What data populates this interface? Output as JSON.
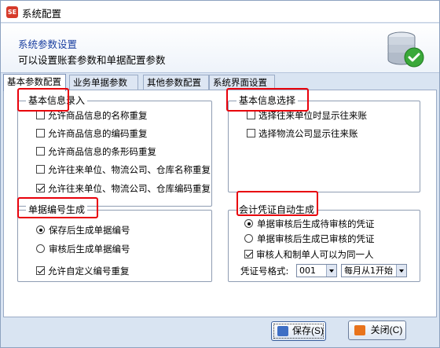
{
  "window": {
    "title": "系统配置",
    "icon_text": "SE"
  },
  "header": {
    "title": "系统参数设置",
    "subtitle": "可以设置账套参数和单据配置参数",
    "icon": "database-check-icon"
  },
  "tabs": [
    {
      "label": "基本参数配置",
      "active": true
    },
    {
      "label": "业务单据参数",
      "active": false
    },
    {
      "label": "其他参数配置",
      "active": false
    },
    {
      "label": "系统界面设置",
      "active": false
    }
  ],
  "basic_info": {
    "title": "基本信息录入",
    "options": [
      {
        "label": "允许商品信息的名称重复",
        "checked": false
      },
      {
        "label": "允许商品信息的编码重复",
        "checked": false
      },
      {
        "label": "允许商品信息的条形码重复",
        "checked": false
      },
      {
        "label": "允许往来单位、物流公司、仓库名称重复",
        "checked": false
      },
      {
        "label": "允许往来单位、物流公司、仓库编码重复",
        "checked": true
      }
    ]
  },
  "basic_select": {
    "title": "基本信息选择",
    "options": [
      {
        "label": "选择往来单位时显示往来账",
        "checked": false
      },
      {
        "label": "选择物流公司显示往来账",
        "checked": false
      }
    ]
  },
  "doc_number": {
    "title": "单据编号生成",
    "radios": [
      {
        "label": "保存后生成单据编号",
        "checked": true
      },
      {
        "label": "审核后生成单据编号",
        "checked": false
      }
    ],
    "checkbox": {
      "label": "允许自定义编号重复",
      "checked": true
    }
  },
  "voucher": {
    "title": "会计凭证自动生成",
    "radios": [
      {
        "label": "单据审核后生成待审核的凭证",
        "checked": true
      },
      {
        "label": "单据审核后生成已审核的凭证",
        "checked": false
      }
    ],
    "checkbox": {
      "label": "审核人和制单人可以为同一人",
      "checked": true
    },
    "format_label": "凭证号格式:",
    "format_value": "001",
    "period_value": "每月从1开始"
  },
  "buttons": {
    "save": "保存(S)",
    "close": "关闭(C)"
  },
  "colors": {
    "highlight": "#e8000b",
    "header_title": "#1a3fa0"
  }
}
